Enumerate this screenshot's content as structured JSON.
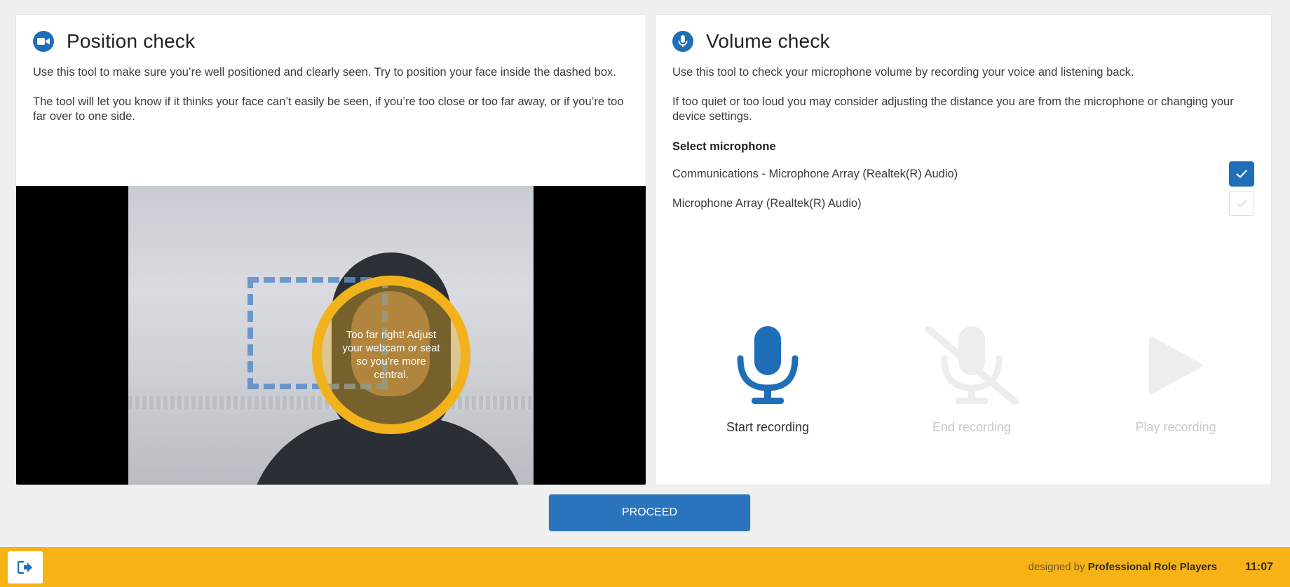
{
  "position_check": {
    "title": "Position check",
    "icon": "video-camera-icon",
    "description_1": "Use this tool to make sure you’re well positioned and clearly seen. Try to position your face inside the dashed box.",
    "description_2": "The tool will let you know if it thinks your face can’t easily be seen, if you’re too close or too far away, or if you’re too far over to one side.",
    "feedback": "Too far right! Adjust your webcam or seat so you’re more central."
  },
  "volume_check": {
    "title": "Volume check",
    "icon": "microphone-icon",
    "description_1": "Use this tool to check your microphone volume by recording your voice and listening back.",
    "description_2": "If too quiet or too loud you may consider adjusting the distance you are from the microphone or changing your device settings.",
    "select_label": "Select microphone",
    "microphones": [
      {
        "name": "Communications - Microphone Array (Realtek(R) Audio)",
        "selected": true
      },
      {
        "name": "Microphone Array (Realtek(R) Audio)",
        "selected": false
      }
    ],
    "controls": {
      "start": "Start recording",
      "end": "End recording",
      "play": "Play recording"
    }
  },
  "proceed_label": "PROCEED",
  "footer": {
    "designed_by": "designed by",
    "brand": "Professional Role Players",
    "time": "11:07"
  },
  "colors": {
    "accent_blue": "#1f6fb8",
    "footer_yellow": "#f7b215",
    "ring_yellow": "#f2b21c",
    "disabled_gray": "#e3e3e3"
  }
}
